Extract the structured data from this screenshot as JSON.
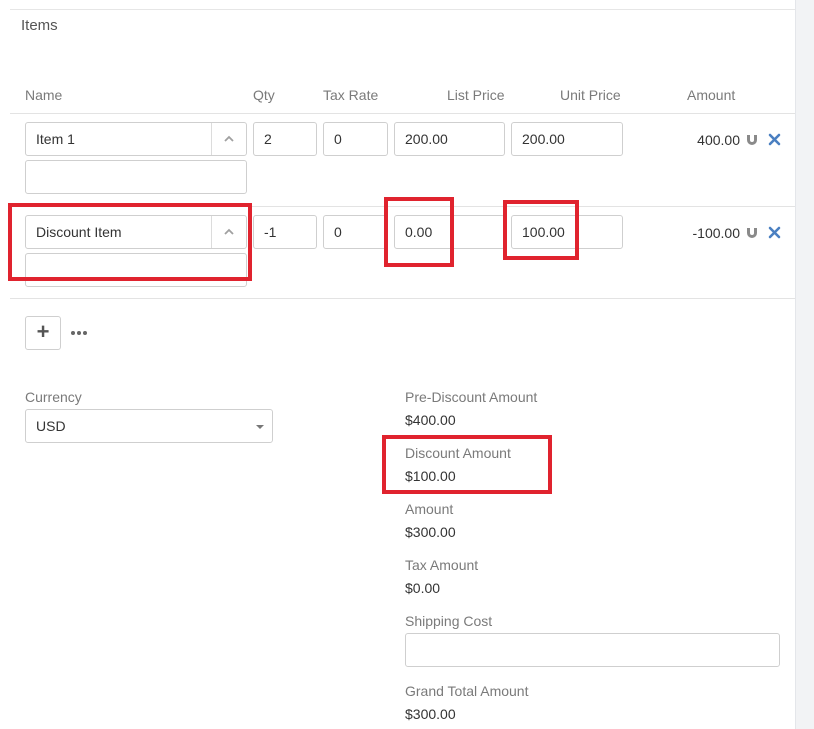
{
  "section": {
    "title": "Items"
  },
  "columns": {
    "name": "Name",
    "qty": "Qty",
    "tax_rate": "Tax Rate",
    "list_price": "List Price",
    "unit_price": "Unit Price",
    "amount": "Amount"
  },
  "rows": [
    {
      "name": "Item 1",
      "description": "",
      "qty": "2",
      "tax_rate": "0",
      "list_price": "200.00",
      "unit_price": "200.00",
      "amount": "400.00"
    },
    {
      "name": "Discount Item",
      "description": "",
      "qty": "-1",
      "tax_rate": "0",
      "list_price": "0.00",
      "unit_price": "100.00",
      "amount": "-100.00"
    }
  ],
  "currency": {
    "label": "Currency",
    "value": "USD"
  },
  "totals": {
    "pre_discount": {
      "label": "Pre-Discount Amount",
      "value": "$400.00"
    },
    "discount": {
      "label": "Discount Amount",
      "value": "$100.00"
    },
    "amount": {
      "label": "Amount",
      "value": "$300.00"
    },
    "tax": {
      "label": "Tax Amount",
      "value": "$0.00"
    },
    "shipping": {
      "label": "Shipping Cost",
      "value": ""
    },
    "grand_total": {
      "label": "Grand Total Amount",
      "value": "$300.00"
    }
  },
  "colors": {
    "highlight": "#e0232e",
    "remove_icon": "#4a7fc1",
    "border": "#cfcfcf"
  },
  "icons": {
    "add": "plus-icon",
    "more": "ellipsis-icon",
    "remove": "close-icon",
    "magnet": "magnet-icon",
    "collapse": "chevron-up-icon"
  }
}
